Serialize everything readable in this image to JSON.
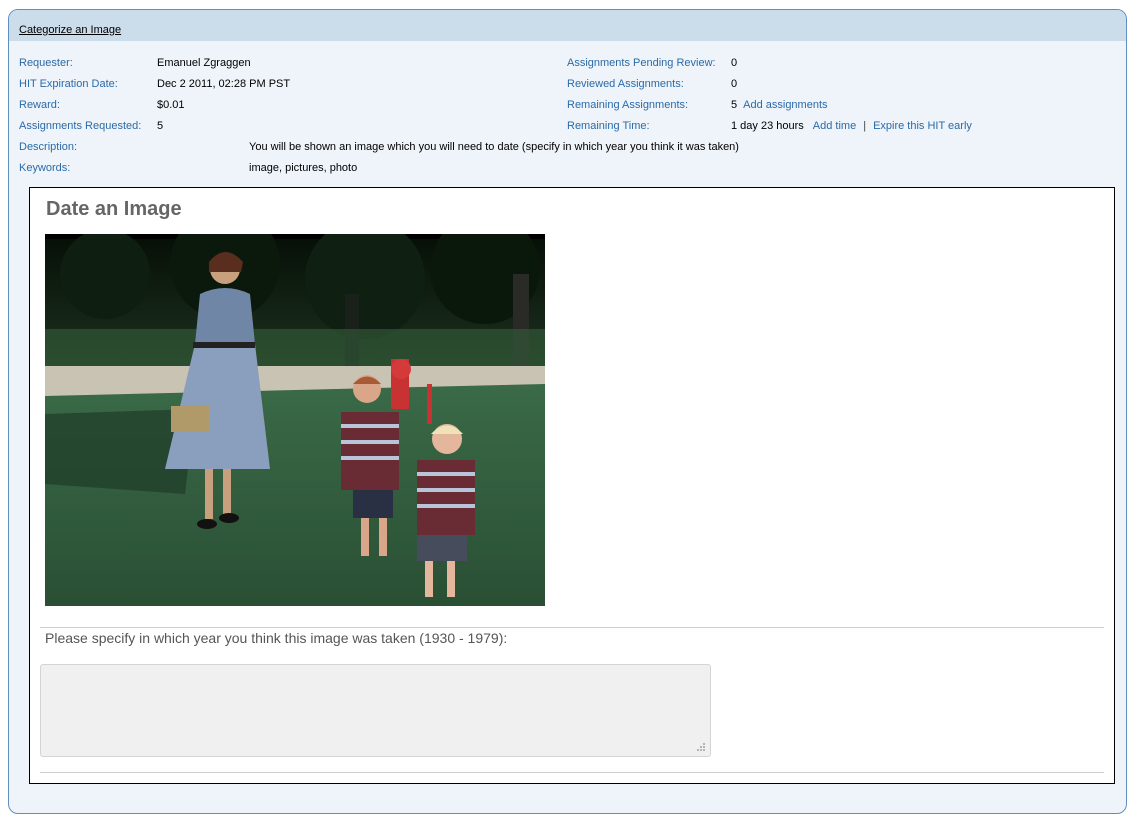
{
  "header": {
    "title": "Categorize an Image"
  },
  "info": {
    "requester_label": "Requester:",
    "requester_value": "Emanuel Zgraggen",
    "expiration_label": "HIT Expiration Date:",
    "expiration_value": "Dec 2 2011, 02:28 PM PST",
    "reward_label": "Reward:",
    "reward_value": "$0.01",
    "requested_label": "Assignments Requested:",
    "requested_value": "5",
    "description_label": "Description:",
    "description_value": "You will be shown an image which you will need to date (specify in which year you think it was taken)",
    "keywords_label": "Keywords:",
    "keywords_value": "image, pictures, photo",
    "pending_label": "Assignments Pending Review:",
    "pending_value": "0",
    "reviewed_label": "Reviewed Assignments:",
    "reviewed_value": "0",
    "remaining_label": "Remaining Assignments:",
    "remaining_value": "5",
    "add_assignments_link": "Add assignments",
    "time_label": "Remaining Time:",
    "time_value": "1 day 23 hours",
    "add_time_link": "Add time",
    "separator": "|",
    "expire_link": "Expire this HIT early"
  },
  "hit": {
    "title": "Date an Image",
    "question": "Please specify in which year you think this image was taken (1930 - 1979):",
    "answer_value": ""
  },
  "colors": {
    "link": "#2b6aa8",
    "header_bg": "#cbdcea",
    "panel_bg": "#eef4f9",
    "border": "#5f8fbf"
  }
}
